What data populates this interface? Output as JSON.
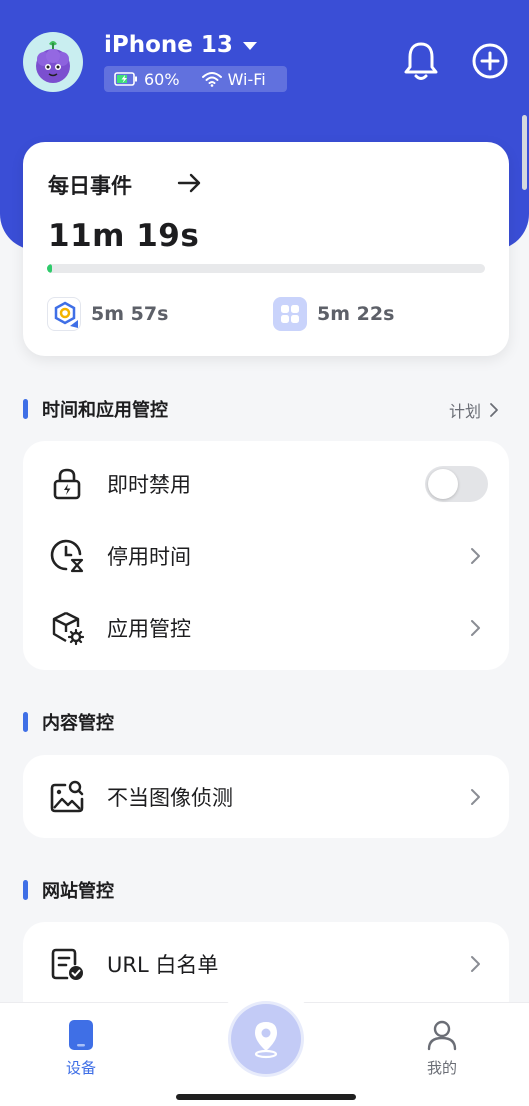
{
  "header": {
    "device_name": "iPhone 13",
    "battery": "60%",
    "network": "Wi-Fi"
  },
  "daily_events": {
    "title": "每日事件",
    "total_time": "11m 19s",
    "progress_fraction": 0.012,
    "apps": [
      {
        "icon": "kids-app-icon",
        "time": "5m 57s"
      },
      {
        "icon": "app-grid-icon",
        "time": "5m 22s"
      }
    ]
  },
  "time_app_control": {
    "section_title": "时间和应用管控",
    "plan_label": "计划",
    "items": [
      {
        "label": "即时禁用",
        "icon": "lock-bolt-icon",
        "control": "toggle",
        "toggle_on": false
      },
      {
        "label": "停用时间",
        "icon": "clock-hourglass-icon",
        "control": "chevron"
      },
      {
        "label": "应用管控",
        "icon": "cube-gear-icon",
        "control": "chevron"
      }
    ]
  },
  "content_control": {
    "section_title": "内容管控",
    "items": [
      {
        "label": "不当图像侦测",
        "icon": "image-search-icon",
        "control": "chevron"
      }
    ]
  },
  "website_control": {
    "section_title": "网站管控",
    "items": [
      {
        "label": "URL 白名单",
        "icon": "list-check-icon",
        "control": "chevron"
      }
    ]
  },
  "tabbar": {
    "tabs": [
      {
        "label": "设备",
        "icon": "device-icon",
        "active": true
      },
      {
        "label": "",
        "icon": "location-pin-icon",
        "active": false
      },
      {
        "label": "我的",
        "icon": "user-icon",
        "active": false
      }
    ]
  },
  "colors": {
    "brand_blue": "#3a4ed6",
    "accent_blue": "#3f6fe6",
    "progress_green": "#2fcb6b"
  }
}
